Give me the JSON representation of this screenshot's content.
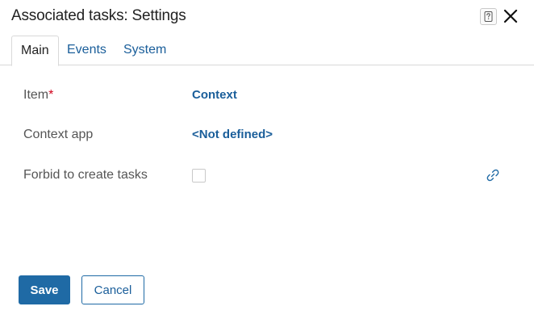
{
  "dialog": {
    "title": "Associated tasks: Settings",
    "help_icon": "question-mark-icon",
    "close_icon": "close-icon"
  },
  "tabs": [
    {
      "label": "Main",
      "active": true
    },
    {
      "label": "Events",
      "active": false
    },
    {
      "label": "System",
      "active": false
    }
  ],
  "form": {
    "item": {
      "label": "Item",
      "required_mark": "*",
      "value": "Context"
    },
    "context_app": {
      "label": "Context app",
      "value": "<Not defined>"
    },
    "forbid": {
      "label": "Forbid to create tasks",
      "checked": false,
      "icon": "link-icon"
    }
  },
  "buttons": {
    "save": "Save",
    "cancel": "Cancel"
  },
  "colors": {
    "accent": "#1f6aa5",
    "link": "#1a5e9a",
    "required": "#d0021b"
  }
}
